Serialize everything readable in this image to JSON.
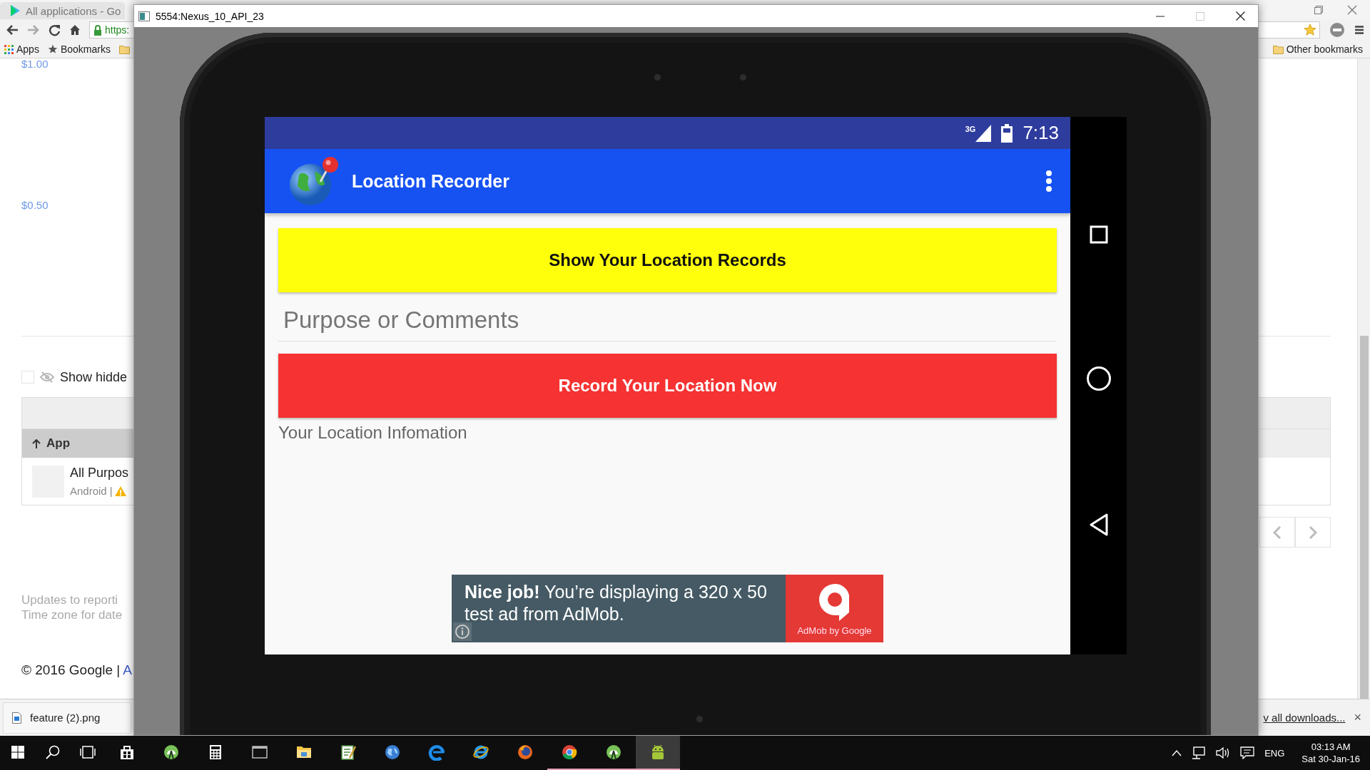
{
  "browser": {
    "tab": {
      "title": "All applications - Go"
    },
    "address": {
      "scheme": "https:"
    },
    "bookmarks": [
      {
        "kind": "apps",
        "label": "Apps"
      },
      {
        "kind": "star",
        "label": "Bookmarks"
      }
    ],
    "other_bookmarks": "Other bookmarks",
    "page": {
      "y_labels": [
        "$1.00",
        "$0.50"
      ],
      "show_hidden": {
        "label": "Show hidde",
        "checked": false
      },
      "table": {
        "sort_column": "App",
        "row": {
          "title": "All Purpos",
          "platform": "Android |"
        }
      },
      "footnotes": [
        "Updates to reporti",
        "Time zone for date"
      ],
      "footer": {
        "copyright": "© 2016 Google |",
        "link": "A"
      }
    },
    "downloads": {
      "file": "feature (2).png",
      "show_all": "v all downloads...",
      "close": "×"
    }
  },
  "emulator": {
    "title": "5554:Nexus_10_API_23",
    "status_bar": {
      "network": "3G",
      "time": "7:13"
    },
    "app_bar": {
      "title": "Location Recorder"
    },
    "buttons": [
      {
        "label": "Show Your Location Records",
        "color": "#ffff0c"
      },
      {
        "label": "Record Your Location Now",
        "color": "#f63232"
      }
    ],
    "comment_field": {
      "placeholder": "Purpose or Comments"
    },
    "info": "Your Location Infomation",
    "ad": {
      "text": "**Nice job!** You’re displaying a 320 x 50 test ad from AdMob.",
      "brand": "AdMob by Google"
    }
  },
  "taskbar": {
    "items": [
      {
        "kind": "start",
        "running": false,
        "active": false
      },
      {
        "kind": "search",
        "running": false,
        "active": false
      },
      {
        "kind": "taskview",
        "running": false,
        "active": false
      },
      {
        "kind": "store",
        "running": false,
        "active": false
      },
      {
        "kind": "studio",
        "running": false,
        "active": false
      },
      {
        "kind": "calculator",
        "running": false,
        "active": false
      },
      {
        "kind": "terminal",
        "running": false,
        "active": false
      },
      {
        "kind": "folder",
        "running": false,
        "active": false
      },
      {
        "kind": "notepad",
        "running": false,
        "active": false
      },
      {
        "kind": "globe",
        "running": false,
        "active": false
      },
      {
        "kind": "edge",
        "running": false,
        "active": false
      },
      {
        "kind": "ie",
        "running": false,
        "active": false
      },
      {
        "kind": "firefox",
        "running": false,
        "active": false
      },
      {
        "kind": "chrome",
        "running": true,
        "active": false
      },
      {
        "kind": "studio",
        "running": true,
        "active": false
      },
      {
        "kind": "android",
        "running": true,
        "active": true
      }
    ],
    "language": "ENG",
    "time": "03:13 AM",
    "date": "Sat 30-Jan-16"
  }
}
